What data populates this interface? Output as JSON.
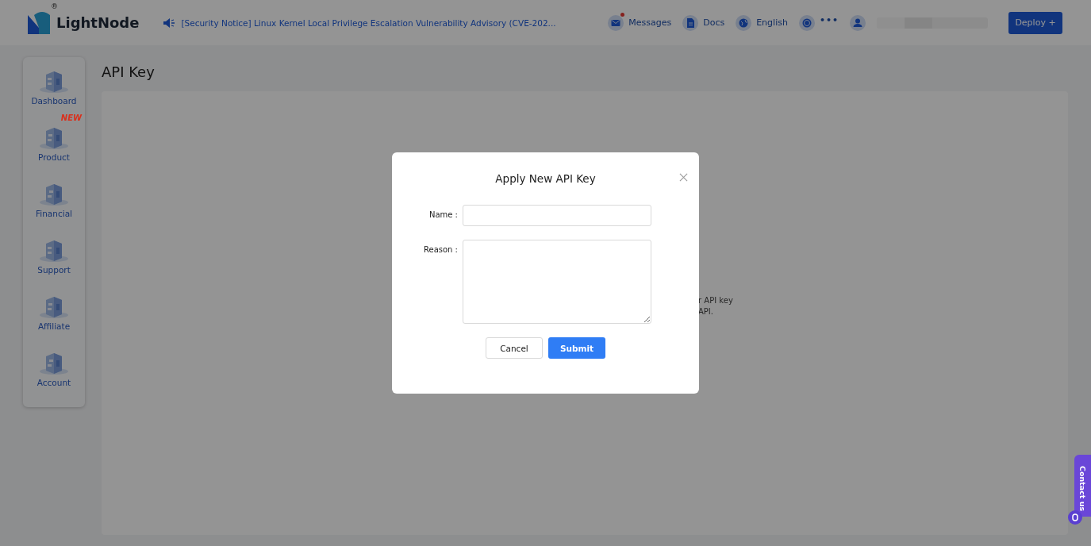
{
  "header": {
    "logo": "LightNode",
    "logo_mark": "®",
    "notice": "[Security Notice] Linux Kernel Local Privilege Escalation Vulnerability Advisory (CVE-202...",
    "links": [
      {
        "kind": "mail",
        "label": "Messages",
        "unread": true
      },
      {
        "kind": "doc",
        "label": "Docs",
        "unread": false
      },
      {
        "kind": "globe",
        "label": "English",
        "unread": false
      },
      {
        "kind": "coin",
        "label": "•••",
        "unread": false
      },
      {
        "kind": "user",
        "unread": false
      }
    ],
    "deploy": "Deploy +"
  },
  "sidebar": {
    "items": [
      {
        "label": "Dashboard"
      },
      {
        "label": "Product",
        "badge": "NEW"
      },
      {
        "label": "Financial"
      },
      {
        "label": "Support"
      },
      {
        "label": "Affiliate"
      },
      {
        "label": "Account"
      }
    ]
  },
  "page": {
    "title": "API Key",
    "hint_lines": [
      "r API key",
      "API."
    ]
  },
  "dialog": {
    "title": "Apply New API Key",
    "fields": [
      {
        "kind": "input",
        "label": "Name :"
      },
      {
        "kind": "textarea",
        "label": "Reason :"
      }
    ],
    "cancel": "Cancel",
    "submit": "Submit"
  },
  "contact": {
    "label": "Contact us"
  }
}
